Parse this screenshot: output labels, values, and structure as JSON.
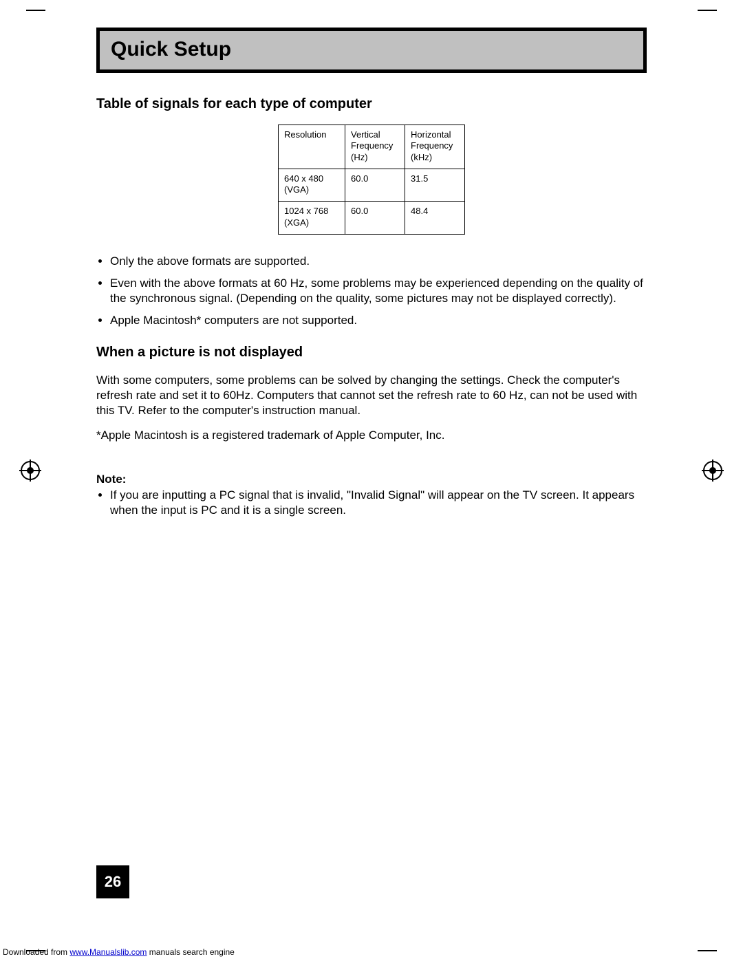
{
  "title": "Quick Setup",
  "section1": {
    "heading": "Table of signals for each type of computer",
    "table": {
      "headers": [
        "Resolution",
        "Vertical\nFrequency\n(Hz)",
        "Horizontal\nFrequency\n(kHz)"
      ],
      "rows": [
        [
          "640 x 480\n(VGA)",
          "60.0",
          "31.5"
        ],
        [
          "1024 x 768\n(XGA)",
          "60.0",
          "48.4"
        ]
      ]
    },
    "bullets": [
      "Only the above formats are supported.",
      "Even with the above formats at 60 Hz, some problems may be experienced depending on the quality of the synchronous signal.  (Depending on the quality, some pictures may not be displayed correctly).",
      "Apple Macintosh* computers are not supported."
    ]
  },
  "section2": {
    "heading": "When a picture is not displayed",
    "para1": "With some computers, some problems can be solved by changing the settings.  Check the computer's refresh rate and set it to 60Hz.  Computers that cannot set the refresh rate to 60 Hz, can not be used with this TV.  Refer to the computer's instruction manual.",
    "para2": "*Apple Macintosh is a registered trademark of Apple Computer, Inc."
  },
  "note": {
    "label": "Note:",
    "items": [
      "If you are inputting a PC signal that is invalid, \"Invalid Signal\" will appear on the TV screen.  It appears when the input is PC and it is a single screen."
    ]
  },
  "page_number": "26",
  "footer": {
    "prefix": "Downloaded from ",
    "link_text": "www.Manualslib.com",
    "suffix": " manuals search engine"
  }
}
